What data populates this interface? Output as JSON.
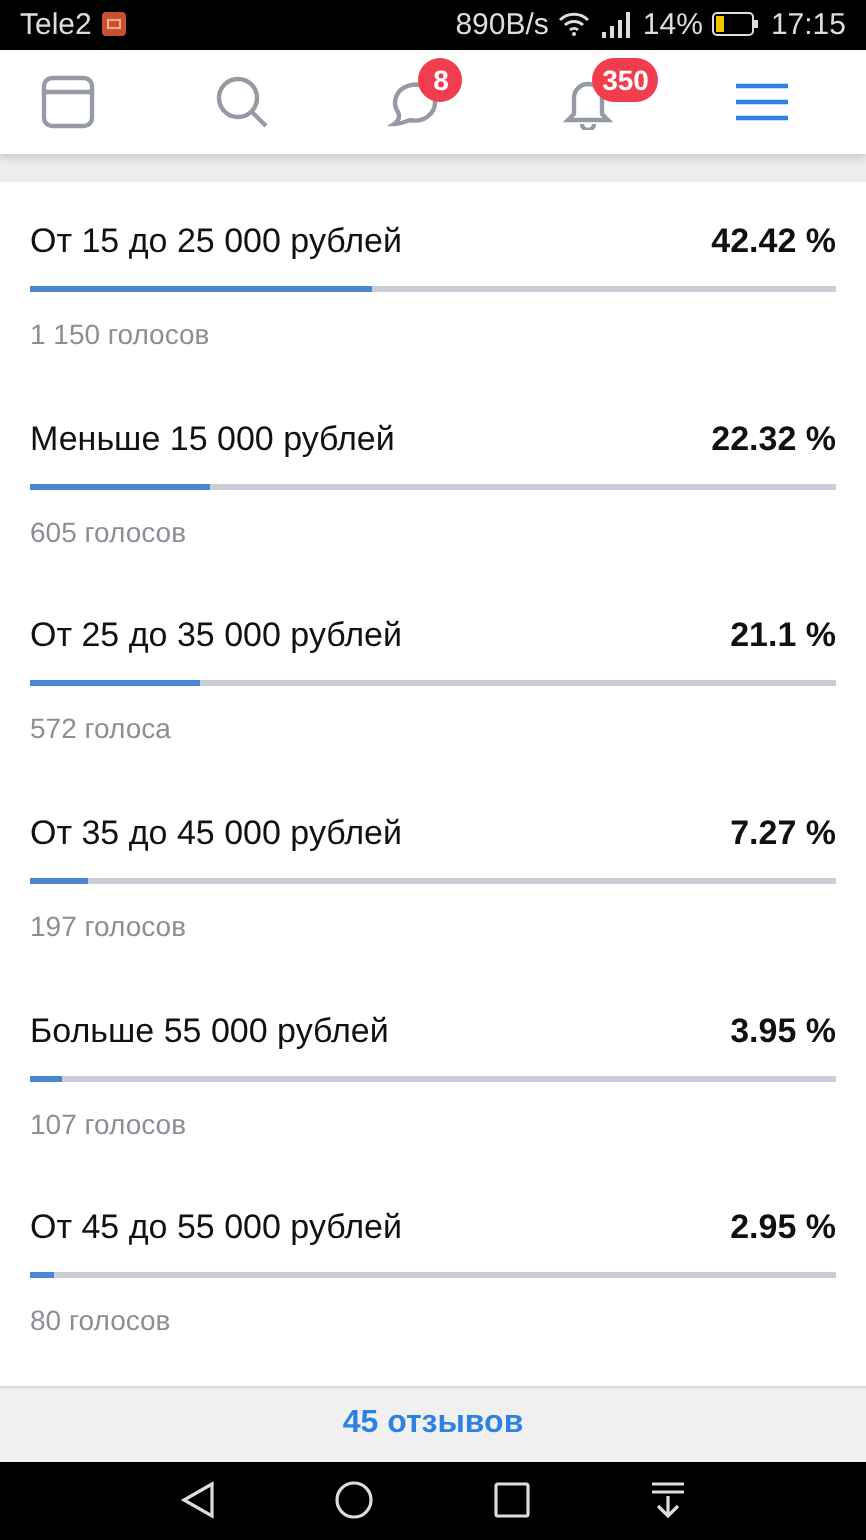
{
  "status_bar": {
    "carrier": "Tele2",
    "speed": "890B/s",
    "battery": "14%",
    "time": "17:15"
  },
  "header": {
    "tabs": [
      {
        "kind": "feed",
        "selected": false
      },
      {
        "kind": "search",
        "selected": false
      },
      {
        "kind": "messages",
        "badge": "8",
        "selected": false
      },
      {
        "kind": "notifications",
        "badge": "350",
        "selected": false
      },
      {
        "kind": "menu",
        "selected": true
      }
    ]
  },
  "poll": {
    "options": [
      {
        "label": "От 15 до 25 000 рублей",
        "percent": "42.42 %",
        "level": 0.4242,
        "votes": "1 150 голосов"
      },
      {
        "label": "Меньше 15 000 рублей",
        "percent": "22.32 %",
        "level": 0.2232,
        "votes": "605 голосов"
      },
      {
        "label": "От 25 до 35 000 рублей",
        "percent": "21.1 %",
        "level": 0.211,
        "votes": "572 голоса"
      },
      {
        "label": "От 35 до 45 000 рублей",
        "percent": "7.27 %",
        "level": 0.0727,
        "votes": "197 голосов"
      },
      {
        "label": "Больше 55 000 рублей",
        "percent": "3.95 %",
        "level": 0.0395,
        "votes": "107 голосов"
      },
      {
        "label": "От 45 до 55 000 рублей",
        "percent": "2.95 %",
        "level": 0.0295,
        "votes": "80 голосов"
      }
    ]
  },
  "footer": {
    "link": "45 отзывов"
  }
}
